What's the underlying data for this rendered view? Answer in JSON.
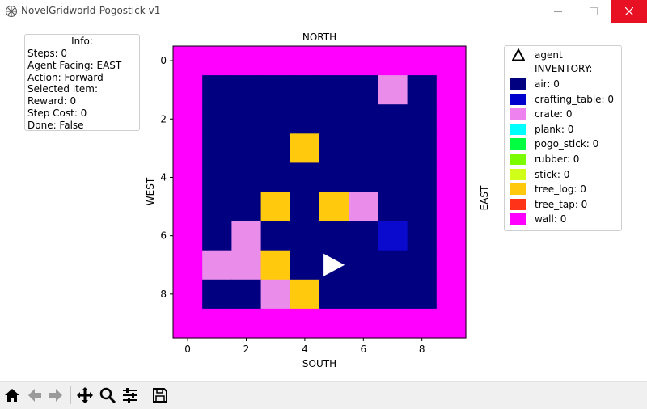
{
  "window": {
    "title": "NovelGridworld-Pogostick-v1",
    "icons": [
      "app-icon",
      "minimize-icon",
      "maximize-icon",
      "close-icon"
    ],
    "close_color": "#e81123"
  },
  "info": {
    "title": "Info:",
    "lines": [
      "Steps: 0",
      "Agent Facing: EAST",
      "Action: Forward",
      "Selected item:",
      "Reward: 0",
      "Step Cost: 0",
      "Done: False"
    ]
  },
  "plot": {
    "top_label": "NORTH",
    "bottom_label": "SOUTH",
    "left_label": "WEST",
    "right_label": "EAST"
  },
  "chart_data": {
    "type": "heatmap",
    "grid_size": 10,
    "x_ticks": [
      "0",
      "2",
      "4",
      "6",
      "8"
    ],
    "y_ticks": [
      "0",
      "2",
      "4",
      "6",
      "8"
    ],
    "xlim": [
      -0.5,
      9.5
    ],
    "ylim": [
      9.5,
      -0.5
    ],
    "cell_values": [
      [
        "wall",
        "wall",
        "wall",
        "wall",
        "wall",
        "wall",
        "wall",
        "wall",
        "wall",
        "wall"
      ],
      [
        "wall",
        "air",
        "air",
        "air",
        "air",
        "air",
        "air",
        "crate",
        "air",
        "wall"
      ],
      [
        "wall",
        "air",
        "air",
        "air",
        "air",
        "air",
        "air",
        "air",
        "air",
        "wall"
      ],
      [
        "wall",
        "air",
        "air",
        "air",
        "tree_log",
        "air",
        "air",
        "air",
        "air",
        "wall"
      ],
      [
        "wall",
        "air",
        "air",
        "air",
        "air",
        "air",
        "air",
        "air",
        "air",
        "wall"
      ],
      [
        "wall",
        "air",
        "air",
        "tree_log",
        "air",
        "tree_log",
        "crate",
        "air",
        "air",
        "wall"
      ],
      [
        "wall",
        "air",
        "crate",
        "air",
        "air",
        "air",
        "air",
        "crafting_table",
        "air",
        "wall"
      ],
      [
        "wall",
        "crate",
        "crate",
        "tree_log",
        "air",
        "air",
        "air",
        "air",
        "air",
        "wall"
      ],
      [
        "wall",
        "air",
        "air",
        "crate",
        "tree_log",
        "air",
        "air",
        "air",
        "air",
        "wall"
      ],
      [
        "wall",
        "wall",
        "wall",
        "wall",
        "wall",
        "wall",
        "wall",
        "wall",
        "wall",
        "wall"
      ]
    ],
    "agent": {
      "row": 7,
      "col": 5,
      "facing": "EAST",
      "color": "#ffffff"
    }
  },
  "legend": {
    "agent_label": "agent",
    "inventory_label": "INVENTORY:",
    "items": [
      {
        "label": "air: 0",
        "color": "#000080"
      },
      {
        "label": "crafting_table: 0",
        "color": "#0000cd"
      },
      {
        "label": "crate: 0",
        "color": "#ee82ee"
      },
      {
        "label": "plank: 0",
        "color": "#00ffff"
      },
      {
        "label": "pogo_stick: 0",
        "color": "#00ff40"
      },
      {
        "label": "rubber: 0",
        "color": "#7cfc00"
      },
      {
        "label": "stick: 0",
        "color": "#d0ff1a"
      },
      {
        "label": "tree_log: 0",
        "color": "#ffc90e"
      },
      {
        "label": "tree_tap: 0",
        "color": "#ff3318"
      },
      {
        "label": "wall: 0",
        "color": "#ff00ff"
      }
    ],
    "cell_colors": {
      "air": "#000080",
      "crafting_table": "#0a0ace",
      "crate": "#ea8cea",
      "tree_log": "#ffc90e",
      "wall": "#ff00ff"
    }
  },
  "toolbar": {
    "buttons": [
      "home-icon",
      "back-icon",
      "forward-icon",
      "pan-icon",
      "zoom-icon",
      "configure-icon",
      "save-icon"
    ]
  }
}
